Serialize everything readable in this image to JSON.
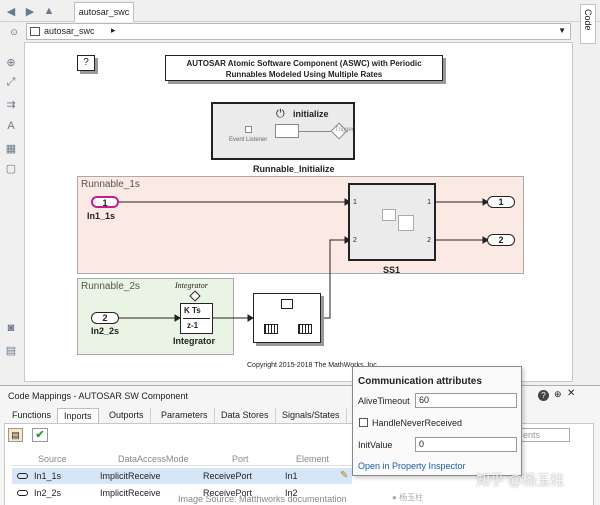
{
  "window": {
    "tab_label": "autosar_swc",
    "breadcrumb": "autosar_swc",
    "side_tab": "Code"
  },
  "diagram": {
    "help_label": "?",
    "title": "AUTOSAR Atomic Software Component (ASWC) with Periodic Runnables Modeled Using Multiple Rates",
    "init_block_label": "initialize",
    "event_listener": "Event Listener",
    "trigger_label": "Trigger",
    "runnable_init_label": "Runnable_Initialize",
    "area1_label": "Runnable_1s",
    "area2_label": "Runnable_2s",
    "in1_num": "1",
    "in1_label": "In1_1s",
    "in2_num": "2",
    "in2_label": "In2_2s",
    "ss1_label": "SS1",
    "ss1_port_in1": "1",
    "ss1_port_in2": "2",
    "ss1_port_out1": "1",
    "ss1_port_out2": "2",
    "out1_num": "1",
    "out2_num": "2",
    "integrator_top": "Integrator",
    "integrator_name": "Integrator",
    "integrator_kts": "K Ts",
    "integrator_z": "z-1",
    "copyright": "Copyright 2015-2018 The MathWorks, Inc."
  },
  "panel": {
    "title": "Code Mappings - AUTOSAR SW Component",
    "tabs": [
      "Functions",
      "Inports",
      "Outports",
      "Parameters",
      "Data Stores",
      "Signals/States"
    ],
    "active_tab": 1,
    "search_placeholder": "ents",
    "columns": [
      "Source",
      "DataAccessMode",
      "Port",
      "Element"
    ],
    "rows": [
      {
        "source": "In1_1s",
        "mode": "ImplicitReceive",
        "port": "ReceivePort",
        "element": "In1"
      },
      {
        "source": "In2_2s",
        "mode": "ImplicitReceive",
        "port": "ReceivePort",
        "element": "In2"
      }
    ]
  },
  "popup": {
    "title": "Communication attributes",
    "alive_label": "AliveTimeout",
    "alive_value": "60",
    "handle_label": "HandleNeverReceived",
    "init_label": "InitValue",
    "init_value": "0",
    "link": "Open in Property Inspector"
  },
  "watermark": {
    "source": "Image Source: Matthworks documentation",
    "zhihu": "知乎 @杨玉柱",
    "zhihu_small": "杨玉柱"
  },
  "colors": {
    "area1_bg": "#fbe9e3",
    "area2_bg": "#eaf4e4",
    "row_selected": "#d6e6f6",
    "link": "#1b5fa8",
    "check_green": "#3a9b3a",
    "inport_ring": "#c0208a"
  }
}
